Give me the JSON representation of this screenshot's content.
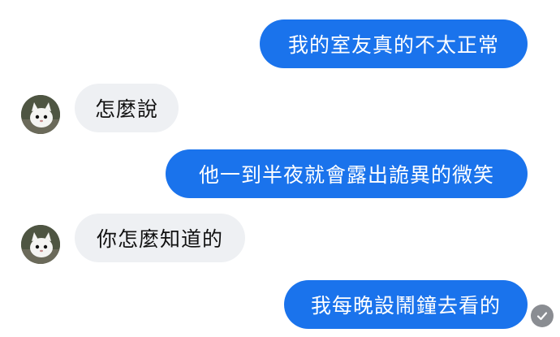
{
  "conversation": {
    "messages": [
      {
        "sender": "me",
        "text": "我的室友真的不太正常"
      },
      {
        "sender": "friend",
        "text": "怎麼說"
      },
      {
        "sender": "me",
        "text": "他一到半夜就會露出詭異的微笑"
      },
      {
        "sender": "friend",
        "text": "你怎麼知道的"
      },
      {
        "sender": "me",
        "text": "我每晚設鬧鐘去看的"
      }
    ]
  },
  "icons": {
    "avatar": "cat-avatar-icon",
    "read_receipt": "checkmark-circle-icon"
  },
  "colors": {
    "sent_bubble": "#1a73ec",
    "received_bubble": "#eef0f3",
    "sent_text": "#ffffff",
    "received_text": "#111111"
  }
}
